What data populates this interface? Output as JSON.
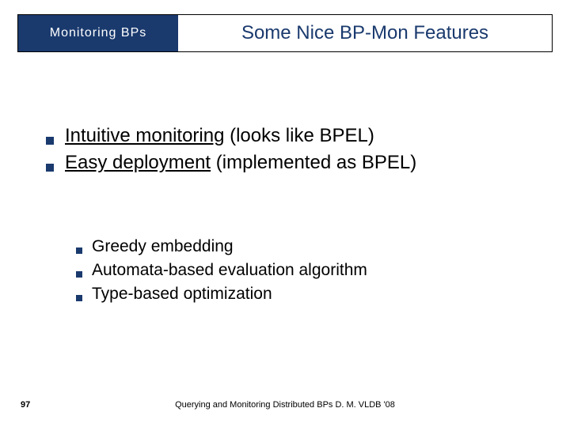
{
  "header": {
    "left": "Monitoring  BPs",
    "right": "Some Nice BP-Mon Features"
  },
  "main_items": [
    {
      "underlined": "Intuitive monitoring",
      "rest": " (looks like BPEL)"
    },
    {
      "underlined": "Easy deployment",
      "rest": " (implemented as BPEL)"
    }
  ],
  "sub_items": [
    "Greedy embedding",
    "Automata-based evaluation algorithm",
    "Type-based optimization"
  ],
  "slide_number": "97",
  "footer": "Querying and Monitoring Distributed BPs D. M. VLDB '08"
}
